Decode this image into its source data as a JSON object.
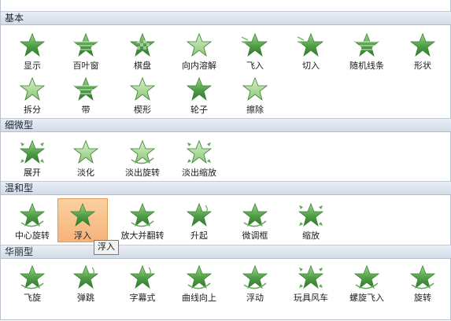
{
  "sections": [
    {
      "title": "基本",
      "items": [
        {
          "label": "显示",
          "icon": "star-plain-icon"
        },
        {
          "label": "百叶窗",
          "icon": "star-blinds-icon"
        },
        {
          "label": "棋盘",
          "icon": "star-checker-icon"
        },
        {
          "label": "向内溶解",
          "icon": "star-dissolve-icon"
        },
        {
          "label": "飞入",
          "icon": "star-fly-in-icon"
        },
        {
          "label": "切入",
          "icon": "star-peek-in-icon"
        },
        {
          "label": "随机线条",
          "icon": "star-random-bars-icon"
        },
        {
          "label": "形状",
          "icon": "star-shape-icon"
        },
        {
          "label": "拆分",
          "icon": "star-split-icon"
        },
        {
          "label": "带",
          "icon": "star-strips-icon"
        },
        {
          "label": "楔形",
          "icon": "star-wedge-icon"
        },
        {
          "label": "轮子",
          "icon": "star-wheel-icon"
        },
        {
          "label": "擦除",
          "icon": "star-wipe-icon"
        }
      ]
    },
    {
      "title": "细微型",
      "items": [
        {
          "label": "展开",
          "icon": "star-expand-icon"
        },
        {
          "label": "淡化",
          "icon": "star-fade-icon"
        },
        {
          "label": "淡出旋转",
          "icon": "star-fade-swivel-icon"
        },
        {
          "label": "淡出缩放",
          "icon": "star-fade-zoom-icon"
        }
      ]
    },
    {
      "title": "温和型",
      "items": [
        {
          "label": "中心旋转",
          "icon": "star-center-revolve-icon"
        },
        {
          "label": "浮入",
          "icon": "star-float-in-icon"
        },
        {
          "label": "放大并翻转",
          "icon": "star-grow-turn-icon"
        },
        {
          "label": "升起",
          "icon": "star-rise-up-icon"
        },
        {
          "label": "微调框",
          "icon": "star-spinner-icon"
        },
        {
          "label": "缩放",
          "icon": "star-zoom-icon"
        }
      ]
    },
    {
      "title": "华丽型",
      "items": [
        {
          "label": "飞旋",
          "icon": "star-boomerang-icon"
        },
        {
          "label": "弹跳",
          "icon": "star-bounce-icon"
        },
        {
          "label": "字幕式",
          "icon": "star-credits-icon"
        },
        {
          "label": "曲线向上",
          "icon": "star-curve-up-icon"
        },
        {
          "label": "浮动",
          "icon": "star-float-icon"
        },
        {
          "label": "玩具风车",
          "icon": "star-pinwheel-icon"
        },
        {
          "label": "螺旋飞入",
          "icon": "star-spiral-in-icon"
        },
        {
          "label": "旋转",
          "icon": "star-spin-icon"
        }
      ]
    }
  ],
  "selected": {
    "section": 2,
    "item": 1
  },
  "tooltip": {
    "text": "浮入"
  },
  "colors": {
    "star_dark": "#3f8a3a",
    "star_light": "#8cc876",
    "header_bg": "#dde4ee",
    "selected_bg": "#f8c08c"
  }
}
